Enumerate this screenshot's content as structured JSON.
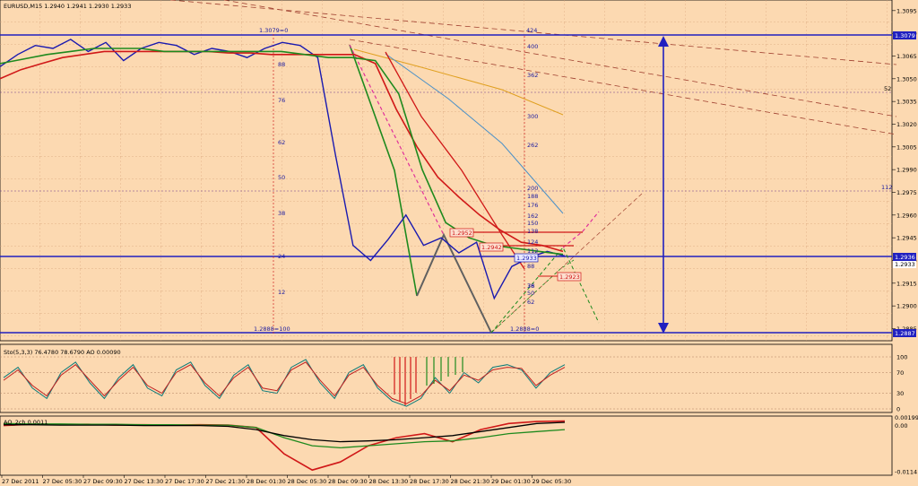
{
  "window": {
    "title": "EURUSD,M15  1.2940 1.2941 1.2930 1.2933"
  },
  "chart_data": [
    {
      "type": "line",
      "title": "EURUSD,M15  1.2940 1.2941 1.2930 1.2933",
      "ylim": [
        1.2877,
        1.3102
      ],
      "y_ticks": [
        "1.3095",
        "1.3080",
        "1.3065",
        "1.3050",
        "1.3035",
        "1.3020",
        "1.3005",
        "1.2990",
        "1.2975",
        "1.2960",
        "1.2945",
        "1.2930",
        "1.2915",
        "1.2900",
        "1.2885"
      ],
      "x_ticks": [
        "27 Dec 2011",
        "27 Dec 05:30",
        "27 Dec 09:30",
        "27 Dec 13:30",
        "27 Dec 17:30",
        "27 Dec 21:30",
        "28 Dec 01:30",
        "28 Dec 05:30",
        "28 Dec 09:30",
        "28 Dec 13:30",
        "28 Dec 17:30",
        "28 Dec 21:30",
        "29 Dec 01:30",
        "29 Dec 05:30"
      ],
      "price_badges": [
        "1.3079",
        "1.2936",
        "1.2933",
        "1.2887"
      ],
      "series": [
        {
          "color": "#1a1ab0",
          "values": [
            1.3058,
            1.3066,
            1.3072,
            1.307,
            1.3076,
            1.3068,
            1.3074,
            1.3062,
            1.307,
            1.3074,
            1.3072,
            1.3066,
            1.307,
            1.3068,
            1.3064,
            1.307,
            1.3074,
            1.3072,
            1.3064,
            1.3,
            1.294,
            1.293,
            1.2944,
            1.296,
            1.294,
            1.2945,
            1.2935,
            1.2942,
            1.2905,
            1.2926,
            1.2932,
            1.2936,
            1.2933
          ]
        },
        {
          "color": "#d01818",
          "values": [
            1.305,
            1.3056,
            1.306,
            1.3064,
            1.3066,
            1.3068,
            1.3068,
            1.3068,
            1.3068,
            1.3068,
            1.3068,
            1.3067,
            1.3067,
            1.3066,
            1.3066,
            1.3066,
            1.3066,
            1.3066,
            1.306,
            1.303,
            1.3005,
            1.2985,
            1.2972,
            1.296,
            1.295,
            1.2942,
            1.294,
            1.2936
          ]
        },
        {
          "color": "#1e8a1e",
          "values": [
            1.306,
            1.3063,
            1.3066,
            1.3068,
            1.307,
            1.307,
            1.307,
            1.3068,
            1.3068,
            1.3068,
            1.3068,
            1.3068,
            1.3068,
            1.3066,
            1.3064,
            1.3064,
            1.3062,
            1.304,
            1.299,
            1.2955,
            1.2945,
            1.294,
            1.2938,
            1.2936,
            1.2934
          ]
        }
      ],
      "fibo_left": {
        "top": "1.3079=0",
        "bottom": "1.2888=100",
        "levels": [
          "88",
          "76",
          "62",
          "50",
          "38",
          "24",
          "12"
        ]
      },
      "fibo_right": {
        "top": "424",
        "bottom": "1.2888=0",
        "levels": [
          "400",
          "362",
          "300",
          "262",
          "200",
          "188",
          "176",
          "162",
          "150",
          "138",
          "124",
          "112",
          "100",
          "88",
          "76",
          "62",
          "50",
          "38"
        ]
      },
      "side_labels": [
        "52",
        "112"
      ],
      "price_tags": [
        {
          "text": "1.2952",
          "color": "#d01818"
        },
        {
          "text": "1.2942",
          "color": "#d01818"
        },
        {
          "text": "1.2923",
          "color": "#d01818"
        },
        {
          "text": "1.2933",
          "color": "#1a1ab0"
        }
      ]
    },
    {
      "type": "line",
      "title": "Sto(5,3,3) 76.4780 78.6790  AO 0.00090",
      "ylim": [
        0,
        100
      ],
      "y_ticks": [
        "100",
        "70",
        "30",
        "0"
      ],
      "series": [
        {
          "color": "#0a7a7a",
          "values": [
            60,
            80,
            40,
            20,
            70,
            90,
            50,
            20,
            60,
            85,
            40,
            25,
            75,
            90,
            45,
            20,
            65,
            85,
            35,
            30,
            80,
            95,
            50,
            20,
            70,
            85,
            40,
            15,
            5,
            20,
            60,
            30,
            70,
            50,
            80,
            85,
            75,
            40,
            70,
            85
          ]
        },
        {
          "color": "#c02020",
          "values": [
            55,
            75,
            45,
            25,
            65,
            85,
            55,
            25,
            55,
            80,
            45,
            30,
            70,
            85,
            50,
            25,
            60,
            80,
            40,
            35,
            75,
            90,
            55,
            25,
            65,
            80,
            45,
            20,
            10,
            25,
            55,
            35,
            65,
            55,
            75,
            80,
            78,
            45,
            65,
            80
          ]
        }
      ]
    },
    {
      "type": "line",
      "title": "AO_2ch 0.0011",
      "ylim": [
        -0.0114,
        0.0019
      ],
      "y_ticks": [
        "0.00199",
        "0.00",
        "-0.0114"
      ],
      "series": [
        {
          "color": "#d01818",
          "values": [
            0.0,
            0.0003,
            0.0002,
            0.0003,
            0.0001,
            0.0002,
            0.0001,
            0.0002,
            0.0001,
            -0.0005,
            -0.007,
            -0.011,
            -0.009,
            -0.005,
            -0.003,
            -0.002,
            -0.004,
            -0.001,
            0.0005,
            0.001,
            0.0011
          ]
        },
        {
          "color": "#1e8a1e",
          "values": [
            0.0005,
            0.0004,
            0.0004,
            0.0003,
            0.0003,
            0.0002,
            0.0002,
            0.0001,
            0.0001,
            -0.0005,
            -0.003,
            -0.005,
            -0.0055,
            -0.005,
            -0.0045,
            -0.004,
            -0.0038,
            -0.003,
            -0.002,
            -0.0015,
            -0.001
          ]
        },
        {
          "color": "#000000",
          "values": [
            0.0002,
            0.0002,
            0.0001,
            0.0001,
            0.0001,
            0.0,
            0.0,
            0.0,
            -0.0002,
            -0.001,
            -0.0025,
            -0.0035,
            -0.004,
            -0.0038,
            -0.0035,
            -0.003,
            -0.0025,
            -0.0015,
            -0.0005,
            0.0005,
            0.0008
          ]
        }
      ]
    }
  ]
}
